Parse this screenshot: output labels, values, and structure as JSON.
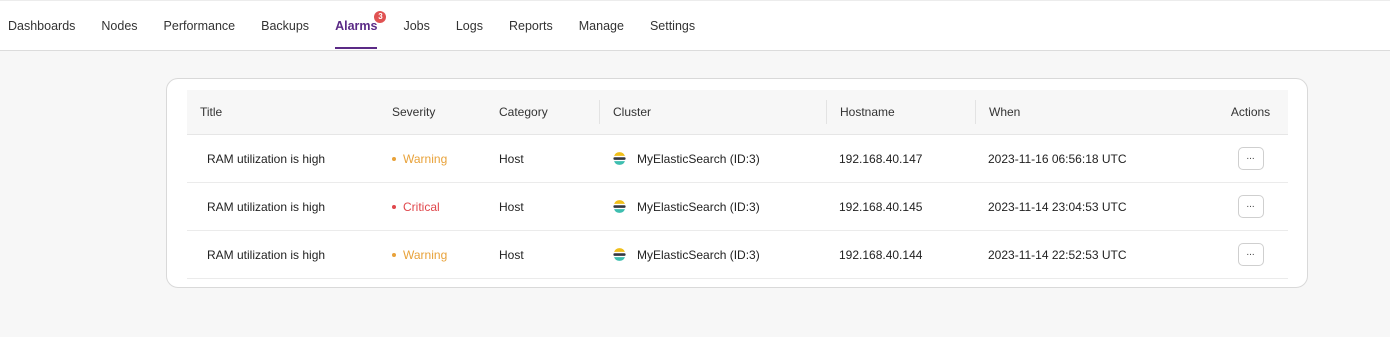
{
  "nav": {
    "items": [
      {
        "label": "Dashboards"
      },
      {
        "label": "Nodes"
      },
      {
        "label": "Performance"
      },
      {
        "label": "Backups"
      },
      {
        "label": "Alarms",
        "badge": "3"
      },
      {
        "label": "Jobs"
      },
      {
        "label": "Logs"
      },
      {
        "label": "Reports"
      },
      {
        "label": "Manage"
      },
      {
        "label": "Settings"
      }
    ],
    "active": "Alarms"
  },
  "colors": {
    "accent": "#5b2a86",
    "warning": "#e8a23a",
    "critical": "#e0474c"
  },
  "table": {
    "headers": {
      "title": "Title",
      "severity": "Severity",
      "category": "Category",
      "cluster": "Cluster",
      "hostname": "Hostname",
      "when": "When",
      "actions": "Actions"
    },
    "rows": [
      {
        "title": "RAM utilization is high",
        "severity": "Warning",
        "severity_color": "#e8a23a",
        "category": "Host",
        "cluster_icon": "elasticsearch-icon",
        "cluster": "MyElasticSearch (ID:3)",
        "hostname": "192.168.40.147",
        "when": "2023-11-16 06:56:18 UTC",
        "action": "..."
      },
      {
        "title": "RAM utilization is high",
        "severity": "Critical",
        "severity_color": "#e0474c",
        "category": "Host",
        "cluster_icon": "elasticsearch-icon",
        "cluster": "MyElasticSearch (ID:3)",
        "hostname": "192.168.40.145",
        "when": "2023-11-14 23:04:53 UTC",
        "action": "..."
      },
      {
        "title": "RAM utilization is high",
        "severity": "Warning",
        "severity_color": "#e8a23a",
        "category": "Host",
        "cluster_icon": "elasticsearch-icon",
        "cluster": "MyElasticSearch (ID:3)",
        "hostname": "192.168.40.144",
        "when": "2023-11-14 22:52:53 UTC",
        "action": "..."
      }
    ]
  }
}
